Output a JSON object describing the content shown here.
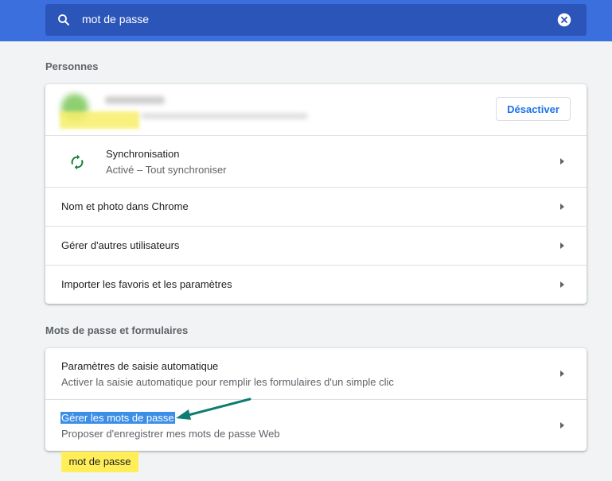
{
  "search": {
    "value": "mot de passe"
  },
  "people_section": {
    "title": "Personnes",
    "disable_button": "Désactiver",
    "sync": {
      "label": "Synchronisation",
      "status": "Activé – Tout synchroniser"
    },
    "items": [
      {
        "label": "Nom et photo dans Chrome"
      },
      {
        "label": "Gérer d'autres utilisateurs"
      },
      {
        "label": "Importer les favoris et les paramètres"
      }
    ]
  },
  "passwords_section": {
    "title": "Mots de passe et formulaires",
    "autofill": {
      "label": "Paramètres de saisie automatique",
      "description": "Activer la saisie automatique pour remplir les formulaires d'un simple clic"
    },
    "manage_passwords": {
      "label": "Gérer les mots de passe",
      "description": "Proposer d'enregistrer mes mots de passe Web"
    }
  },
  "search_match_tooltip": "mot de passe",
  "colors": {
    "header": "#3c6fde",
    "search_box": "#2b55b9",
    "accent_blue": "#1a73e8",
    "sync_green": "#188038",
    "highlight_yellow": "#ffee58",
    "annotation_arrow": "#0e7c72",
    "selection": "#3d8ee7"
  }
}
